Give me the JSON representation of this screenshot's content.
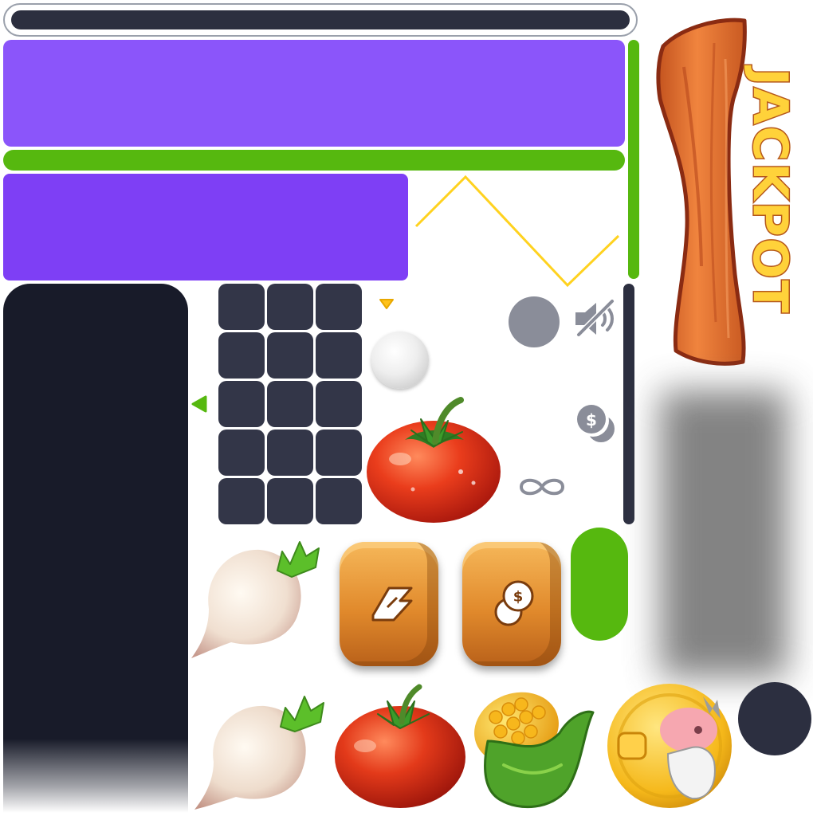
{
  "jackpot_sign": {
    "label": "JACKPOT"
  },
  "icons": {
    "mute": "speaker-muted-icon",
    "coins": "dollar-coins-icon",
    "infinity": "infinity-icon",
    "lightning": "lightning-icon",
    "coin_button": "coin-dollar-icon",
    "arrow_down": "triangle-down-icon",
    "arrow_left": "triangle-left-icon"
  },
  "coin_symbol": "$",
  "colors": {
    "purple_primary": "#8b55fa",
    "purple_secondary": "#7e3ff5",
    "green": "#56b80f",
    "dark": "#2c2f40",
    "panel_dark": "#181b29",
    "gray": "#8a8d99",
    "wood": "#e18a2c",
    "jackpot_text": "#ffd23a",
    "line_yellow": "#ffd21f"
  }
}
